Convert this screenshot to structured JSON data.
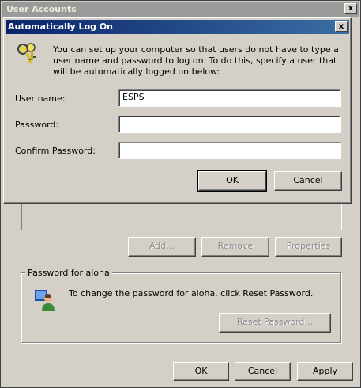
{
  "outer": {
    "title": "User Accounts",
    "close_label": "x",
    "add_label": "Add...",
    "remove_label": "Remove",
    "properties_label": "Properties",
    "password_group_label": "Password for aloha",
    "password_text": "To change the password for aloha, click Reset Password.",
    "reset_password_label": "Reset Password...",
    "ok_label": "OK",
    "cancel_label": "Cancel",
    "apply_label": "Apply"
  },
  "dialog": {
    "title": "Automatically Log On",
    "close_label": "x",
    "description": "You can set up your computer so that users do not have to type a user name and password to log on. To do this, specify a user that will be automatically logged on below:",
    "username_label": "User name:",
    "username_value": "ESPS",
    "password_label": "Password:",
    "password_value": "",
    "confirm_label": "Confirm Password:",
    "confirm_value": "",
    "ok_label": "OK",
    "cancel_label": "Cancel"
  },
  "icons": {
    "keys": "keys-icon",
    "user": "user-icon"
  }
}
